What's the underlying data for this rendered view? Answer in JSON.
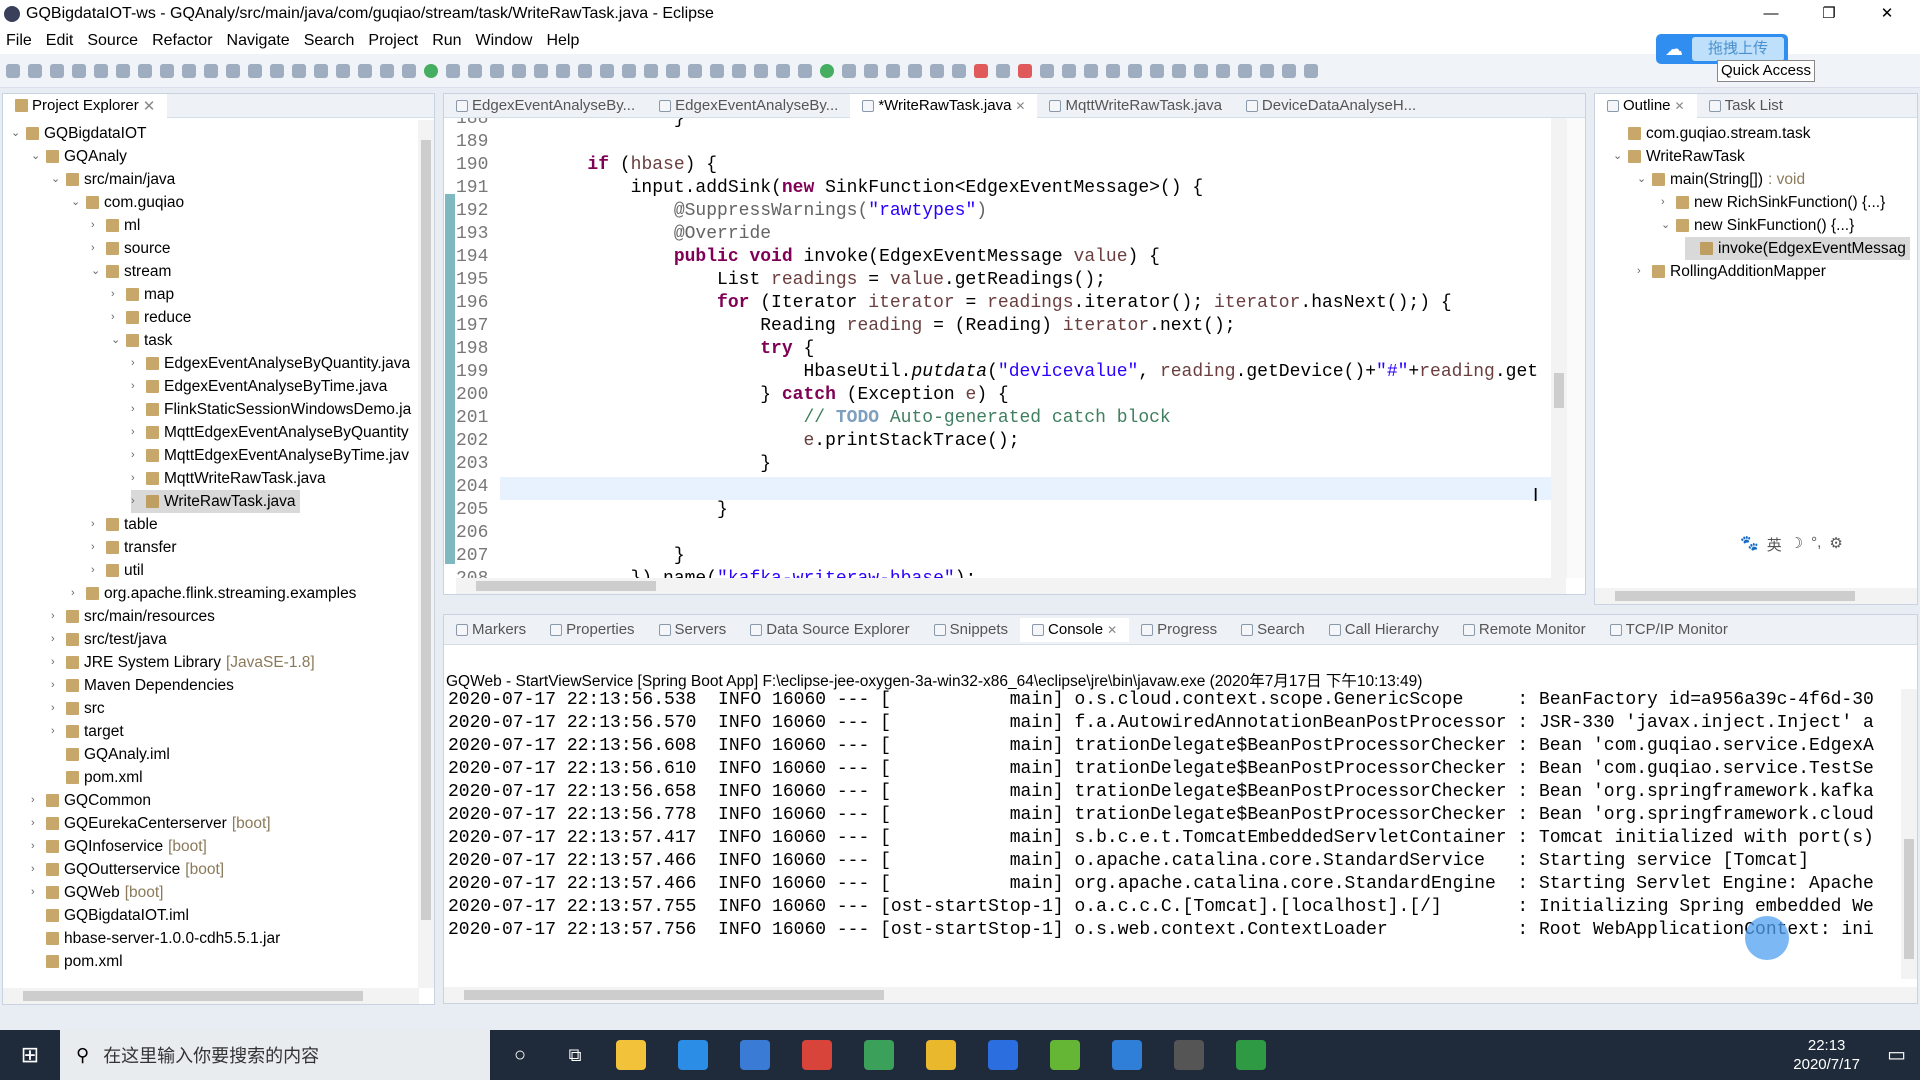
{
  "window": {
    "title": "GQBigdataIOT-ws - GQAnaly/src/main/java/com/guqiao/stream/task/WriteRawTask.java - Eclipse",
    "minimize": "—",
    "restore": "❐",
    "close": "✕"
  },
  "menu": [
    "File",
    "Edit",
    "Source",
    "Refactor",
    "Navigate",
    "Search",
    "Project",
    "Run",
    "Window",
    "Help"
  ],
  "overlay": {
    "upload_label": "拖拽上传"
  },
  "quick_access": "Quick Access",
  "project_explorer": {
    "title": "Project Explorer",
    "items": [
      {
        "label": "GQBigdataIOT",
        "depth": 0,
        "exp": "open"
      },
      {
        "label": "GQAnaly",
        "depth": 1,
        "exp": "open"
      },
      {
        "label": "src/main/java",
        "depth": 2,
        "exp": "open"
      },
      {
        "label": "com.guqiao",
        "depth": 3,
        "exp": "open"
      },
      {
        "label": "ml",
        "depth": 4,
        "exp": "closed"
      },
      {
        "label": "source",
        "depth": 4,
        "exp": "closed"
      },
      {
        "label": "stream",
        "depth": 4,
        "exp": "open"
      },
      {
        "label": "map",
        "depth": 5,
        "exp": "closed"
      },
      {
        "label": "reduce",
        "depth": 5,
        "exp": "closed"
      },
      {
        "label": "task",
        "depth": 5,
        "exp": "open"
      },
      {
        "label": "EdgexEventAnalyseByQuantity.java",
        "depth": 6,
        "exp": "closed"
      },
      {
        "label": "EdgexEventAnalyseByTime.java",
        "depth": 6,
        "exp": "closed"
      },
      {
        "label": "FlinkStaticSessionWindowsDemo.ja",
        "depth": 6,
        "exp": "closed"
      },
      {
        "label": "MqttEdgexEventAnalyseByQuantity",
        "depth": 6,
        "exp": "closed"
      },
      {
        "label": "MqttEdgexEventAnalyseByTime.jav",
        "depth": 6,
        "exp": "closed"
      },
      {
        "label": "MqttWriteRawTask.java",
        "depth": 6,
        "exp": "closed"
      },
      {
        "label": "WriteRawTask.java",
        "depth": 6,
        "exp": "closed",
        "selected": true
      },
      {
        "label": "table",
        "depth": 4,
        "exp": "closed"
      },
      {
        "label": "transfer",
        "depth": 4,
        "exp": "closed"
      },
      {
        "label": "util",
        "depth": 4,
        "exp": "closed"
      },
      {
        "label": "org.apache.flink.streaming.examples",
        "depth": 3,
        "exp": "closed"
      },
      {
        "label": "src/main/resources",
        "depth": 2,
        "exp": "closed"
      },
      {
        "label": "src/test/java",
        "depth": 2,
        "exp": "closed"
      },
      {
        "label": "JRE System Library",
        "suffix": "[JavaSE-1.8]",
        "depth": 2,
        "exp": "closed"
      },
      {
        "label": "Maven Dependencies",
        "depth": 2,
        "exp": "closed"
      },
      {
        "label": "src",
        "depth": 2,
        "exp": "closed"
      },
      {
        "label": "target",
        "depth": 2,
        "exp": "closed"
      },
      {
        "label": "GQAnaly.iml",
        "depth": 2,
        "exp": "none"
      },
      {
        "label": "pom.xml",
        "depth": 2,
        "exp": "none"
      },
      {
        "label": "GQCommon",
        "depth": 1,
        "exp": "closed"
      },
      {
        "label": "GQEurekaCenterserver",
        "suffix": "[boot]",
        "depth": 1,
        "exp": "closed"
      },
      {
        "label": "GQInfoservice",
        "suffix": "[boot]",
        "depth": 1,
        "exp": "closed"
      },
      {
        "label": "GQOutterservice",
        "suffix": "[boot]",
        "depth": 1,
        "exp": "closed"
      },
      {
        "label": "GQWeb",
        "suffix": "[boot]",
        "depth": 1,
        "exp": "closed"
      },
      {
        "label": "GQBigdataIOT.iml",
        "depth": 1,
        "exp": "none"
      },
      {
        "label": "hbase-server-1.0.0-cdh5.5.1.jar",
        "depth": 1,
        "exp": "none"
      },
      {
        "label": "pom.xml",
        "depth": 1,
        "exp": "none"
      }
    ]
  },
  "editor": {
    "tabs": [
      {
        "label": "EdgexEventAnalyseBy..."
      },
      {
        "label": "EdgexEventAnalyseBy..."
      },
      {
        "label": "*WriteRawTask.java",
        "active": true
      },
      {
        "label": "MqttWriteRawTask.java"
      },
      {
        "label": "DeviceDataAnalyseH..."
      }
    ],
    "lines": [
      {
        "n": "188",
        "seg": [
          [
            "                }",
            ""
          ]
        ]
      },
      {
        "n": "189",
        "seg": []
      },
      {
        "n": "190",
        "seg": [
          [
            "        ",
            ""
          ],
          [
            "if",
            "kw"
          ],
          [
            " (",
            ""
          ],
          [
            "hbase",
            "var"
          ],
          [
            ") {",
            ""
          ]
        ]
      },
      {
        "n": "191",
        "seg": [
          [
            "            input.addSink(",
            ""
          ],
          [
            "new",
            "kw"
          ],
          [
            " SinkFunction<EdgexEventMessage>() {",
            ""
          ]
        ]
      },
      {
        "n": "192",
        "seg": [
          [
            "                ",
            ""
          ],
          [
            "@SuppressWarnings(",
            "ann"
          ],
          [
            "\"rawtypes\"",
            "str"
          ],
          [
            ")",
            "ann"
          ]
        ]
      },
      {
        "n": "193",
        "seg": [
          [
            "                ",
            ""
          ],
          [
            "@Override",
            "ann"
          ]
        ]
      },
      {
        "n": "194",
        "seg": [
          [
            "                ",
            ""
          ],
          [
            "public",
            "kw"
          ],
          [
            " ",
            ""
          ],
          [
            "void",
            "kw"
          ],
          [
            " invoke(EdgexEventMessage ",
            ""
          ],
          [
            "value",
            "var"
          ],
          [
            ") {",
            ""
          ]
        ]
      },
      {
        "n": "195",
        "seg": [
          [
            "                    List ",
            ""
          ],
          [
            "readings",
            "var"
          ],
          [
            " = ",
            ""
          ],
          [
            "value",
            "var"
          ],
          [
            ".getReadings();",
            ""
          ]
        ]
      },
      {
        "n": "196",
        "seg": [
          [
            "                    ",
            ""
          ],
          [
            "for",
            "kw"
          ],
          [
            " (Iterator ",
            ""
          ],
          [
            "iterator",
            "var"
          ],
          [
            " = ",
            ""
          ],
          [
            "readings",
            "var"
          ],
          [
            ".iterator(); ",
            ""
          ],
          [
            "iterator",
            "var"
          ],
          [
            ".hasNext();) {",
            ""
          ]
        ]
      },
      {
        "n": "197",
        "seg": [
          [
            "                        Reading ",
            ""
          ],
          [
            "reading",
            "var"
          ],
          [
            " = (Reading) ",
            ""
          ],
          [
            "iterator",
            "var"
          ],
          [
            ".next();",
            ""
          ]
        ]
      },
      {
        "n": "198",
        "seg": [
          [
            "                        ",
            ""
          ],
          [
            "try",
            "kw"
          ],
          [
            " {",
            ""
          ]
        ]
      },
      {
        "n": "199",
        "seg": [
          [
            "                            HbaseUtil.",
            ""
          ],
          [
            "putdata",
            "it"
          ],
          [
            "(",
            ""
          ],
          [
            "\"devicevalue\"",
            "str"
          ],
          [
            ", ",
            ""
          ],
          [
            "reading",
            "var"
          ],
          [
            ".getDevice()+",
            ""
          ],
          [
            "\"#\"",
            "str"
          ],
          [
            "+",
            ""
          ],
          [
            "reading",
            "var"
          ],
          [
            ".get",
            ""
          ]
        ]
      },
      {
        "n": "200",
        "seg": [
          [
            "                        } ",
            ""
          ],
          [
            "catch",
            "kw"
          ],
          [
            " (Exception ",
            ""
          ],
          [
            "e",
            "var"
          ],
          [
            ") {",
            ""
          ]
        ]
      },
      {
        "n": "201",
        "seg": [
          [
            "                            ",
            ""
          ],
          [
            "// ",
            "cm"
          ],
          [
            "TODO",
            "todo"
          ],
          [
            " Auto-generated catch block",
            "cm"
          ]
        ]
      },
      {
        "n": "202",
        "seg": [
          [
            "                            ",
            ""
          ],
          [
            "e",
            "var"
          ],
          [
            ".printStackTrace();",
            ""
          ]
        ]
      },
      {
        "n": "203",
        "seg": [
          [
            "                        }",
            ""
          ]
        ]
      },
      {
        "n": "204",
        "seg": []
      },
      {
        "n": "205",
        "seg": [
          [
            "                    }",
            ""
          ]
        ]
      },
      {
        "n": "206",
        "seg": []
      },
      {
        "n": "207",
        "seg": [
          [
            "                }",
            ""
          ]
        ]
      },
      {
        "n": "208",
        "seg": [
          [
            "            }).name(",
            ""
          ],
          [
            "\"kafka-writeraw-hbase\"",
            "str"
          ],
          [
            ");",
            ""
          ]
        ]
      }
    ]
  },
  "outline": {
    "tabs": [
      {
        "label": "Outline",
        "active": true
      },
      {
        "label": "Task List"
      }
    ],
    "items": [
      {
        "label": "com.guqiao.stream.task",
        "depth": 0,
        "exp": "none"
      },
      {
        "label": "WriteRawTask",
        "depth": 0,
        "exp": "open"
      },
      {
        "label": "main(String[])",
        "type": " : void",
        "depth": 1,
        "exp": "open"
      },
      {
        "label": "new RichSinkFunction() {...}",
        "depth": 2,
        "exp": "closed"
      },
      {
        "label": "new SinkFunction() {...}",
        "depth": 2,
        "exp": "open"
      },
      {
        "label": "invoke(EdgexEventMessag",
        "depth": 3,
        "exp": "none",
        "selected": true
      },
      {
        "label": "RollingAdditionMapper",
        "depth": 1,
        "exp": "closed"
      }
    ]
  },
  "ime_toolbar": [
    "🐾",
    "英",
    "☽",
    "°,",
    "⚙"
  ],
  "bottom": {
    "tabs": [
      {
        "label": "Markers"
      },
      {
        "label": "Properties"
      },
      {
        "label": "Servers"
      },
      {
        "label": "Data Source Explorer"
      },
      {
        "label": "Snippets"
      },
      {
        "label": "Console",
        "active": true
      },
      {
        "label": "Progress"
      },
      {
        "label": "Search"
      },
      {
        "label": "Call Hierarchy"
      },
      {
        "label": "Remote Monitor"
      },
      {
        "label": "TCP/IP Monitor"
      }
    ],
    "console_header": "GQWeb - StartViewService [Spring Boot App] F:\\eclipse-jee-oxygen-3a-win32-x86_64\\eclipse\\jre\\bin\\javaw.exe (2020年7月17日 下午10:13:49)",
    "log": [
      "2020-07-17 22:13:56.538  INFO 16060 --- [           main] o.s.cloud.context.scope.GenericScope     : BeanFactory id=a956a39c-4f6d-30",
      "2020-07-17 22:13:56.570  INFO 16060 --- [           main] f.a.AutowiredAnnotationBeanPostProcessor : JSR-330 'javax.inject.Inject' a",
      "2020-07-17 22:13:56.608  INFO 16060 --- [           main] trationDelegate$BeanPostProcessorChecker : Bean 'com.guqiao.service.EdgexA",
      "2020-07-17 22:13:56.610  INFO 16060 --- [           main] trationDelegate$BeanPostProcessorChecker : Bean 'com.guqiao.service.TestSe",
      "2020-07-17 22:13:56.658  INFO 16060 --- [           main] trationDelegate$BeanPostProcessorChecker : Bean 'org.springframework.kafka",
      "2020-07-17 22:13:56.778  INFO 16060 --- [           main] trationDelegate$BeanPostProcessorChecker : Bean 'org.springframework.cloud",
      "2020-07-17 22:13:57.417  INFO 16060 --- [           main] s.b.c.e.t.TomcatEmbeddedServletContainer : Tomcat initialized with port(s)",
      "2020-07-17 22:13:57.466  INFO 16060 --- [           main] o.apache.catalina.core.StandardService   : Starting service [Tomcat]",
      "2020-07-17 22:13:57.466  INFO 16060 --- [           main] org.apache.catalina.core.StandardEngine  : Starting Servlet Engine: Apache",
      "2020-07-17 22:13:57.755  INFO 16060 --- [ost-startStop-1] o.a.c.c.C.[Tomcat].[localhost].[/]       : Initializing Spring embedded We",
      "2020-07-17 22:13:57.756  INFO 16060 --- [ost-startStop-1] o.s.web.context.ContextLoader            : Root WebApplicationContext: ini"
    ]
  },
  "taskbar": {
    "search_placeholder": "在这里输入你要搜索的内容",
    "time": "22:13",
    "date": "2020/7/17",
    "app_colors": [
      "#f3c23b",
      "#2b8de6",
      "#3a7bd5",
      "#d8443a",
      "#3aa05a",
      "#e9b82c",
      "#2a6ee0",
      "#66b636",
      "#2f7fd8",
      "#555555",
      "#2f9a44"
    ]
  }
}
